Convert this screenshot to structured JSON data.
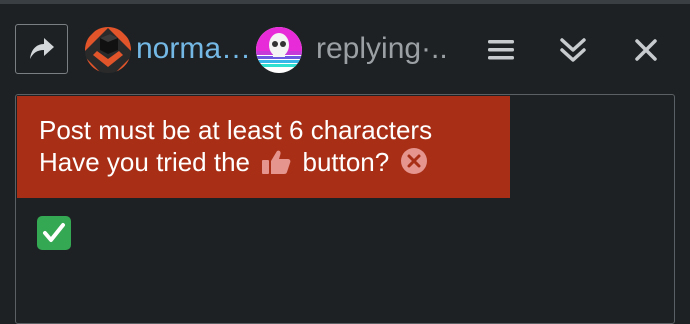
{
  "header": {
    "reply_icon": "share-arrow-icon",
    "username": "norma…",
    "replying_to": "replying·..",
    "menu_icon": "hamburger-menu-icon",
    "collapse_icon": "double-chevron-down-icon",
    "close_icon": "close-icon"
  },
  "popup": {
    "line1": "Post must be at least 6 characters",
    "line2_before": "Have you tried the",
    "line2_after": "button?",
    "like_icon": "thumbs-up-icon",
    "dismiss_icon": "dismiss-x-icon"
  },
  "composer": {
    "content_emoji": "✅"
  },
  "colors": {
    "background": "#1e2124",
    "popup_bg": "#a82f16",
    "username": "#74b9e6",
    "muted_text": "#9aa0a4"
  }
}
